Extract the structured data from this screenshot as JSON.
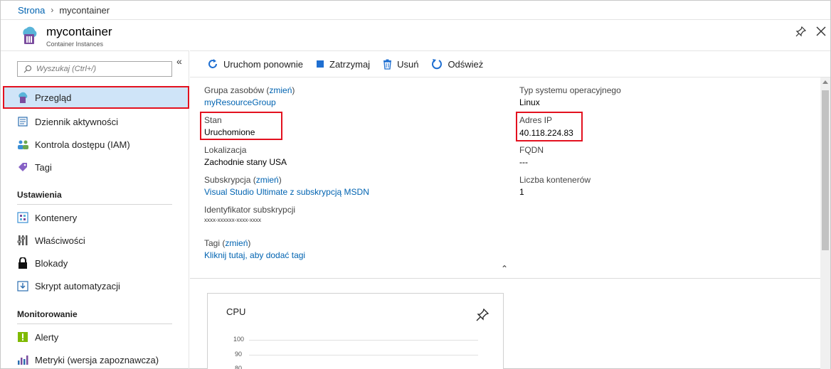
{
  "breadcrumb": {
    "root": "Strona",
    "current": "mycontainer"
  },
  "header": {
    "title": "mycontainer",
    "subtitle": "Container Instances"
  },
  "search": {
    "placeholder": "Wyszukaj (Ctrl+/)"
  },
  "nav": {
    "items": [
      {
        "label": "Przegląd",
        "icon": "cloud-container-icon"
      },
      {
        "label": "Dziennik aktywności",
        "icon": "activity-log-icon"
      },
      {
        "label": "Kontrola dostępu (IAM)",
        "icon": "users-icon"
      },
      {
        "label": "Tagi",
        "icon": "tag-icon"
      }
    ],
    "settings_header": "Ustawienia",
    "settings": [
      {
        "label": "Kontenery",
        "icon": "containers-icon"
      },
      {
        "label": "Właściwości",
        "icon": "properties-icon"
      },
      {
        "label": "Blokady",
        "icon": "lock-icon"
      },
      {
        "label": "Skrypt automatyzacji",
        "icon": "download-script-icon"
      }
    ],
    "monitoring_header": "Monitorowanie",
    "monitoring": [
      {
        "label": "Alerty",
        "icon": "alert-icon"
      },
      {
        "label": "Metryki (wersja zapoznawcza)",
        "icon": "metrics-icon"
      }
    ]
  },
  "toolbar": {
    "restart": "Uruchom ponownie",
    "stop": "Zatrzymaj",
    "delete": "Usuń",
    "refresh": "Odśwież"
  },
  "essentials": {
    "resource_group_label": "Grupa zasobów",
    "change": "zmień",
    "resource_group_value": "myResourceGroup",
    "state_label": "Stan",
    "state_value": "Uruchomione",
    "location_label": "Lokalizacja",
    "location_value": "Zachodnie stany USA",
    "subscription_label": "Subskrypcja",
    "subscription_value": "Visual Studio Ultimate z subskrypcją MSDN",
    "subscription_id_label": "Identyfikator subskrypcji",
    "subscription_id_value": "xxxx-xxxxxx-xxxx-xxxx",
    "os_label": "Typ systemu operacyjnego",
    "os_value": "Linux",
    "ip_label": "Adres IP",
    "ip_value": "40.118.224.83",
    "fqdn_label": "FQDN",
    "fqdn_value": "---",
    "containers_count_label": "Liczba kontenerów",
    "containers_count_value": "1",
    "tags_label": "Tagi",
    "tags_add": "Kliknij tutaj, aby dodać tagi"
  },
  "cpu_tile": {
    "title": "CPU",
    "ticks": [
      "100",
      "90",
      "80"
    ]
  },
  "colors": {
    "accent": "#0063b1",
    "highlight": "#e3111f",
    "active_bg": "#cfe4f8"
  }
}
